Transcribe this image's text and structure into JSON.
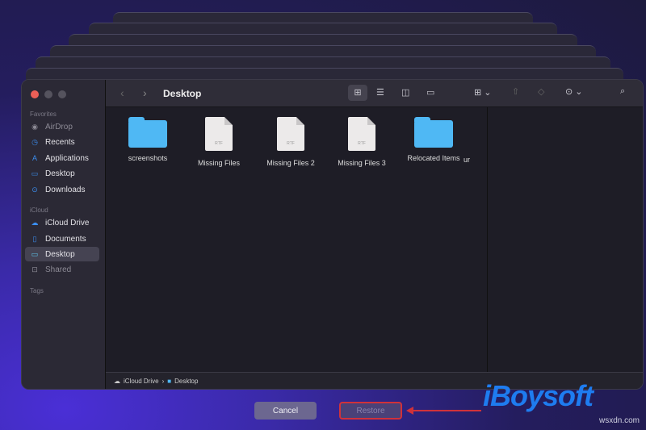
{
  "sidebar": {
    "favorites_label": "Favorites",
    "favorites": [
      {
        "label": "AirDrop",
        "icon": "airdrop-icon"
      },
      {
        "label": "Recents",
        "icon": "clock-icon"
      },
      {
        "label": "Applications",
        "icon": "applications-icon"
      },
      {
        "label": "Desktop",
        "icon": "desktop-icon"
      },
      {
        "label": "Downloads",
        "icon": "download-icon"
      }
    ],
    "icloud_label": "iCloud",
    "icloud": [
      {
        "label": "iCloud Drive",
        "icon": "cloud-icon"
      },
      {
        "label": "Documents",
        "icon": "document-icon"
      },
      {
        "label": "Desktop",
        "icon": "desktop-icon",
        "selected": true
      },
      {
        "label": "Shared",
        "icon": "shared-folder-icon"
      }
    ],
    "tags_label": "Tags"
  },
  "toolbar": {
    "title": "Desktop"
  },
  "files": [
    {
      "name": "screenshots",
      "type": "folder"
    },
    {
      "name": "Missing Files",
      "type": "rtf"
    },
    {
      "name": "Missing Files 2",
      "type": "rtf"
    },
    {
      "name": "Missing Files 3",
      "type": "rtf"
    },
    {
      "name": "Relocated Items",
      "type": "folder"
    },
    {
      "name": "ur",
      "type": "partial"
    }
  ],
  "rtf_label": "RTF",
  "pathbar": {
    "items": [
      "iCloud Drive",
      "Desktop"
    ],
    "sep": "›"
  },
  "dialog": {
    "cancel": "Cancel",
    "restore": "Restore"
  },
  "branding": {
    "logo": "iBoysoft",
    "watermark": "wsxdn.com"
  },
  "colors": {
    "accent": "#4fb8f4",
    "highlight": "#d0323a"
  }
}
